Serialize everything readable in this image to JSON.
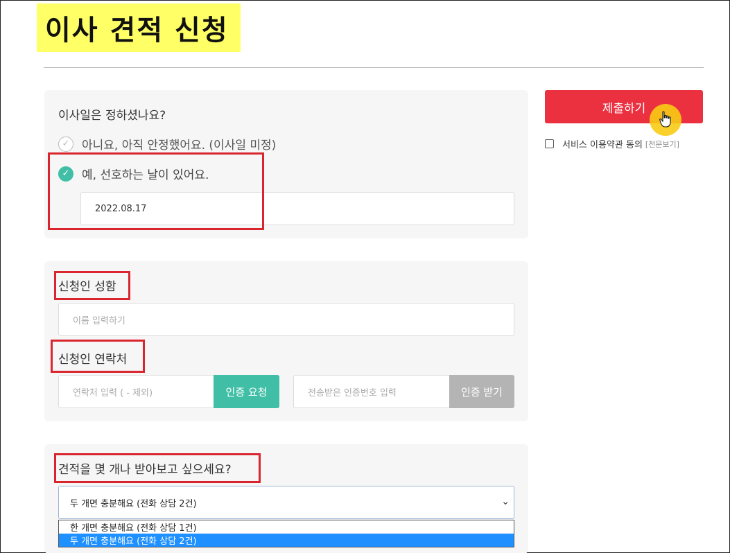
{
  "page": {
    "title": "이사 견적 신청"
  },
  "move_date": {
    "question": "이사일은 정하셨나요?",
    "option_no": "아니요, 아직 안정했어요. (이사일 미정)",
    "option_yes": "예, 선호하는 날이 있어요.",
    "date_value": "2022.08.17"
  },
  "applicant": {
    "name_label": "신청인 성함",
    "name_placeholder": "이름 입력하기",
    "contact_label": "신청인 연락처",
    "phone_placeholder": "연락처 입력 ( - 제외)",
    "request_btn": "인증 요청",
    "code_placeholder": "전송받은 인증번호 입력",
    "receive_btn": "인증 받기"
  },
  "quotes": {
    "question": "견적을 몇 개나 받아보고 싶으세요?",
    "selected": "두 개면 충분해요 (전화 상담 2건)",
    "options": [
      "한 개면 충분해요 (전화 상담 1건)",
      "두 개면 충분해요 (전화 상담 2건)"
    ]
  },
  "sidebar": {
    "submit": "제출하기",
    "terms": "서비스 이용약관 동의",
    "terms_link": "[전문보기]"
  },
  "colors": {
    "accent_green": "#40bfa6",
    "submit_red": "#eb3040",
    "highlight_yellow": "#ffff66",
    "annotation_red": "#d9262e"
  }
}
